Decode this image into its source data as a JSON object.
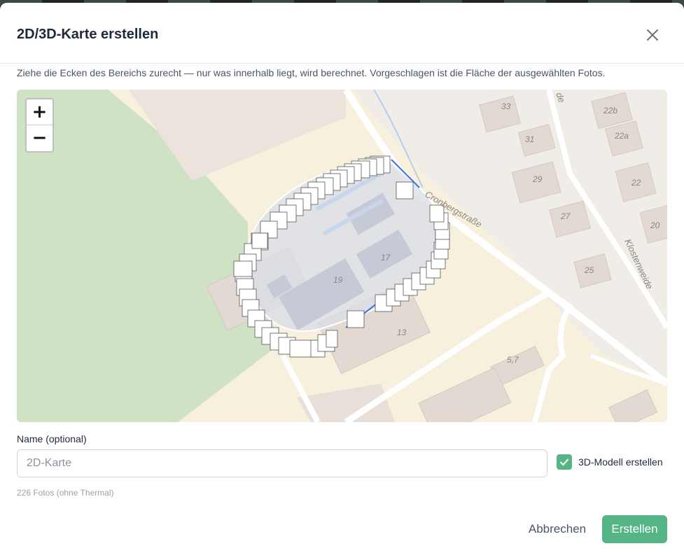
{
  "dialog": {
    "title": "2D/3D-Karte erstellen",
    "hint": "Ziehe die Ecken des Bereichs zurecht — nur was innerhalb liegt, wird berechnet. Vorgeschlagen ist die Fläche der ausgewählten Fotos."
  },
  "map": {
    "zoom_in_label": "+",
    "zoom_out_label": "−",
    "street_labels": [
      "Cronbergstraße",
      "Klostenweide",
      "de"
    ],
    "house_numbers": [
      "33",
      "22b",
      "22a",
      "31",
      "29",
      "22",
      "27",
      "20",
      "25",
      "17",
      "19",
      "13",
      "5,7"
    ],
    "colors": {
      "background": "#f0ece8",
      "park": "#cfe3c4",
      "residential": "#f6f0dc",
      "building": "#e2d9d2",
      "selection_fill": "#d8dde8",
      "selection_border": "#3b6fe0"
    }
  },
  "form": {
    "name_label": "Name (optional)",
    "name_value": "",
    "name_placeholder": "2D-Karte",
    "checkbox_label": "3D-Modell erstellen",
    "checkbox_checked": true,
    "photo_count": "226 Fotos (ohne Thermal)"
  },
  "buttons": {
    "cancel": "Abbrechen",
    "create": "Erstellen"
  },
  "icons": {
    "close": "close-icon",
    "check": "check-icon"
  }
}
